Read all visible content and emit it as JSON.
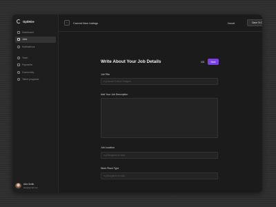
{
  "app": {
    "name": "OptiHire"
  },
  "sidebar": {
    "primary": [
      {
        "label": "Dashboard",
        "icon": "grid-icon",
        "active": false
      },
      {
        "label": "Jobs",
        "icon": "briefcase-icon",
        "active": true
      },
      {
        "label": "Notifications",
        "icon": "bell-icon",
        "active": false
      }
    ],
    "secondary": [
      {
        "label": "Team",
        "icon": "team-icon"
      },
      {
        "label": "Payments",
        "icon": "card-icon"
      },
      {
        "label": "Community",
        "icon": "community-icon"
      },
      {
        "label": "Talent programs",
        "icon": "star-icon"
      }
    ],
    "user": {
      "name": "Alex Smith",
      "email": "alex@gmail.com"
    }
  },
  "header": {
    "breadcrumb": "Current New  Listings",
    "cancel_label": "Cancel",
    "draft_label": "Save To Draft"
  },
  "form": {
    "title": "Write About Your Job  Details",
    "step": "1/3",
    "next_label": "Next",
    "fields": {
      "job_title": {
        "label": "Job Title",
        "placeholder": "e.g.Senior Product Designer"
      },
      "description": {
        "label": "Add Your Job Description",
        "placeholder": ""
      },
      "location": {
        "label": "Job Location",
        "placeholder": "e.g.Bangalore,in india"
      },
      "work_place": {
        "label": "Work Place Type",
        "placeholder": "e.g.Bangalore,in india"
      }
    }
  },
  "colors": {
    "accent": "#7b3fe4",
    "background": "#1b1b1b"
  }
}
